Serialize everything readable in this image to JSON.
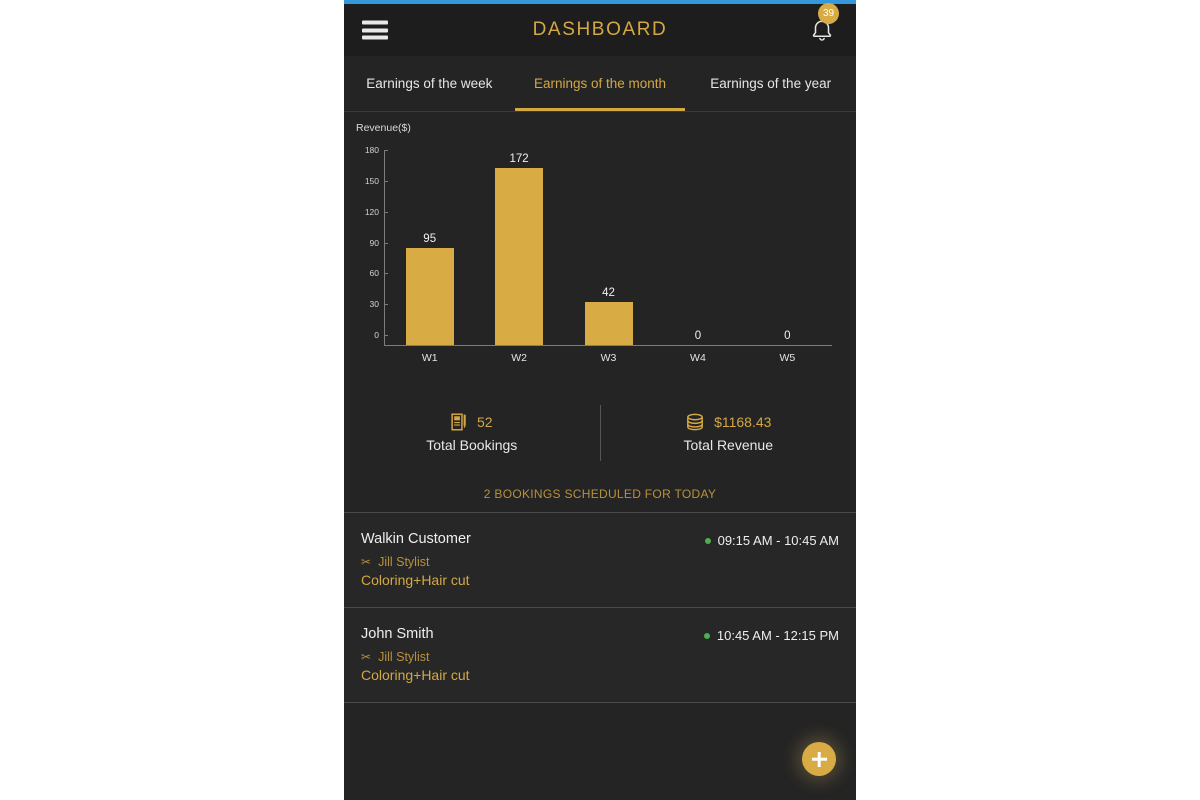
{
  "app": {
    "title": "DASHBOARD",
    "menu_icon": "hamburger-menu-icon",
    "bell_icon": "notification-bell-icon",
    "notification_count": "39",
    "accent_color": "#d4a843",
    "status_bar_color": "#3498db",
    "background_color": "#242424"
  },
  "tabs": [
    {
      "label": "Earnings of the week",
      "active": false
    },
    {
      "label": "Earnings of the month",
      "active": true
    },
    {
      "label": "Earnings of the year",
      "active": false
    }
  ],
  "chart_data": {
    "type": "bar",
    "title": "",
    "ylabel": "Revenue($)",
    "xlabel": "",
    "categories": [
      "W1",
      "W2",
      "W3",
      "W4",
      "W5"
    ],
    "values": [
      95,
      172,
      42,
      0,
      0
    ],
    "value_labels": [
      "95",
      "172",
      "42",
      "0",
      "0"
    ],
    "yticks": [
      0,
      30,
      60,
      90,
      120,
      150,
      180
    ],
    "ytick_labels": [
      "0",
      "30",
      "60",
      "90",
      "120",
      "150",
      "180"
    ],
    "ylim": [
      0,
      190
    ],
    "grid": false,
    "legend": false,
    "bar_color": "#d9ab45"
  },
  "summary": {
    "bookings": {
      "icon": "notebook-pen-icon",
      "value": "52",
      "label": "Total Bookings"
    },
    "revenue": {
      "icon": "coins-stack-icon",
      "value": "$1168.43",
      "label": "Total Revenue"
    }
  },
  "today_note": "2 BOOKINGS SCHEDULED FOR TODAY",
  "bookings": [
    {
      "name": "Walkin Customer",
      "stylist_icon": "scissors-icon",
      "stylist": "Jill Stylist",
      "service": "Coloring+Hair cut",
      "time": "09:15 AM - 10:45 AM",
      "status_color": "#4caf50"
    },
    {
      "name": "John Smith",
      "stylist_icon": "scissors-icon",
      "stylist": "Jill Stylist",
      "service": "Coloring+Hair cut",
      "time": "10:45 AM - 12:15 PM",
      "status_color": "#4caf50"
    }
  ],
  "fab": {
    "icon": "plus-icon",
    "label": "Add booking"
  }
}
